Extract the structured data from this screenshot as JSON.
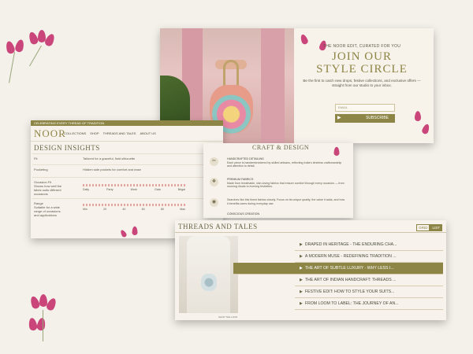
{
  "newsletter": {
    "kicker": "THE NOOR EDIT, CURATED FOR YOU",
    "headline_line1": "JOIN OUR",
    "headline_line2": "STYLE CIRCLE",
    "blurb": "Be the first to catch new drops, festive collections, and exclusive offers — straight from our studio to your inbox.",
    "email_placeholder": "EMAIL",
    "subscribe_label": "SUBSCRIBE",
    "arrow_icon": "chevron-right-icon"
  },
  "site": {
    "announcement": "CELEBRATING EVERY THREAD OF TRADITION",
    "logo": "NOOR",
    "nav": [
      "COLLECTIONS",
      "SHOP",
      "THREADS AND TALES",
      "ABOUT US"
    ]
  },
  "design_insights": {
    "title": "DESIGN INSIGHTS",
    "rows": [
      {
        "label": "Fit",
        "value": "Tailored for a graceful, fluid silhouette"
      },
      {
        "label": "Pocketing",
        "value": "Hidden side pockets for comfort and ease"
      },
      {
        "label": "Occasion Fit",
        "sub": "Shows how well the fabric suits different occasions"
      },
      {
        "label": "Range",
        "sub": "Suitable for a wide range of occasions and applications"
      }
    ],
    "occasion_scale": [
      "Daily",
      "Party",
      "Work",
      "Gala",
      "Brigal"
    ],
    "range_scale": [
      "Min",
      "20",
      "40",
      "60",
      "80",
      "Max"
    ]
  },
  "craft_design": {
    "title": "CRAFT & DESIGN",
    "items": [
      {
        "icon": "needle-icon",
        "heading": "HANDCRAFTED DETAILING",
        "text": "Each piece is handembroidered by skilled artisans, reflecting India's timeless craftsmanship and attention to detail."
      },
      {
        "icon": "fabric-icon",
        "heading": "PREMIUM FABRICS",
        "text": "Made from breathable, skin-loving fabrics that ensure comfort through every occasion — from morning rituals to evening festivities."
      },
      {
        "icon": "globe-icon",
        "heading": "",
        "text": "Searches like this finest fabrics closely. Focus on its unique quality, the value it adds, and how it benefits users during everyday use."
      }
    ],
    "footer": "CONSCIOUS CREATION"
  },
  "threads_tales": {
    "title": "THREADS AND TALES",
    "toggle": [
      "GRID",
      "LIST"
    ],
    "active_toggle": "LIST",
    "articles": [
      "DRAPED IN HERITAGE - THE ENDURING CHA...",
      "A MODERN MUSE - REDEFINING TRADITION ...",
      "THE ART OF SUBTLE LUXURY - WHY LESS I...",
      "THE ART OF INDIAN HANDCRAFT: THREADS ...",
      "FESTIVE EDIT: HOW TO STYLE YOUR SUITS...",
      "FROM LOOM TO LABEL: THE JOURNEY OF AN..."
    ],
    "active_index": 2,
    "caption": "SHOP THE LOOK"
  },
  "colors": {
    "accent": "#8d8545",
    "background": "#f4f0ea",
    "lotus": "#c9457a"
  }
}
